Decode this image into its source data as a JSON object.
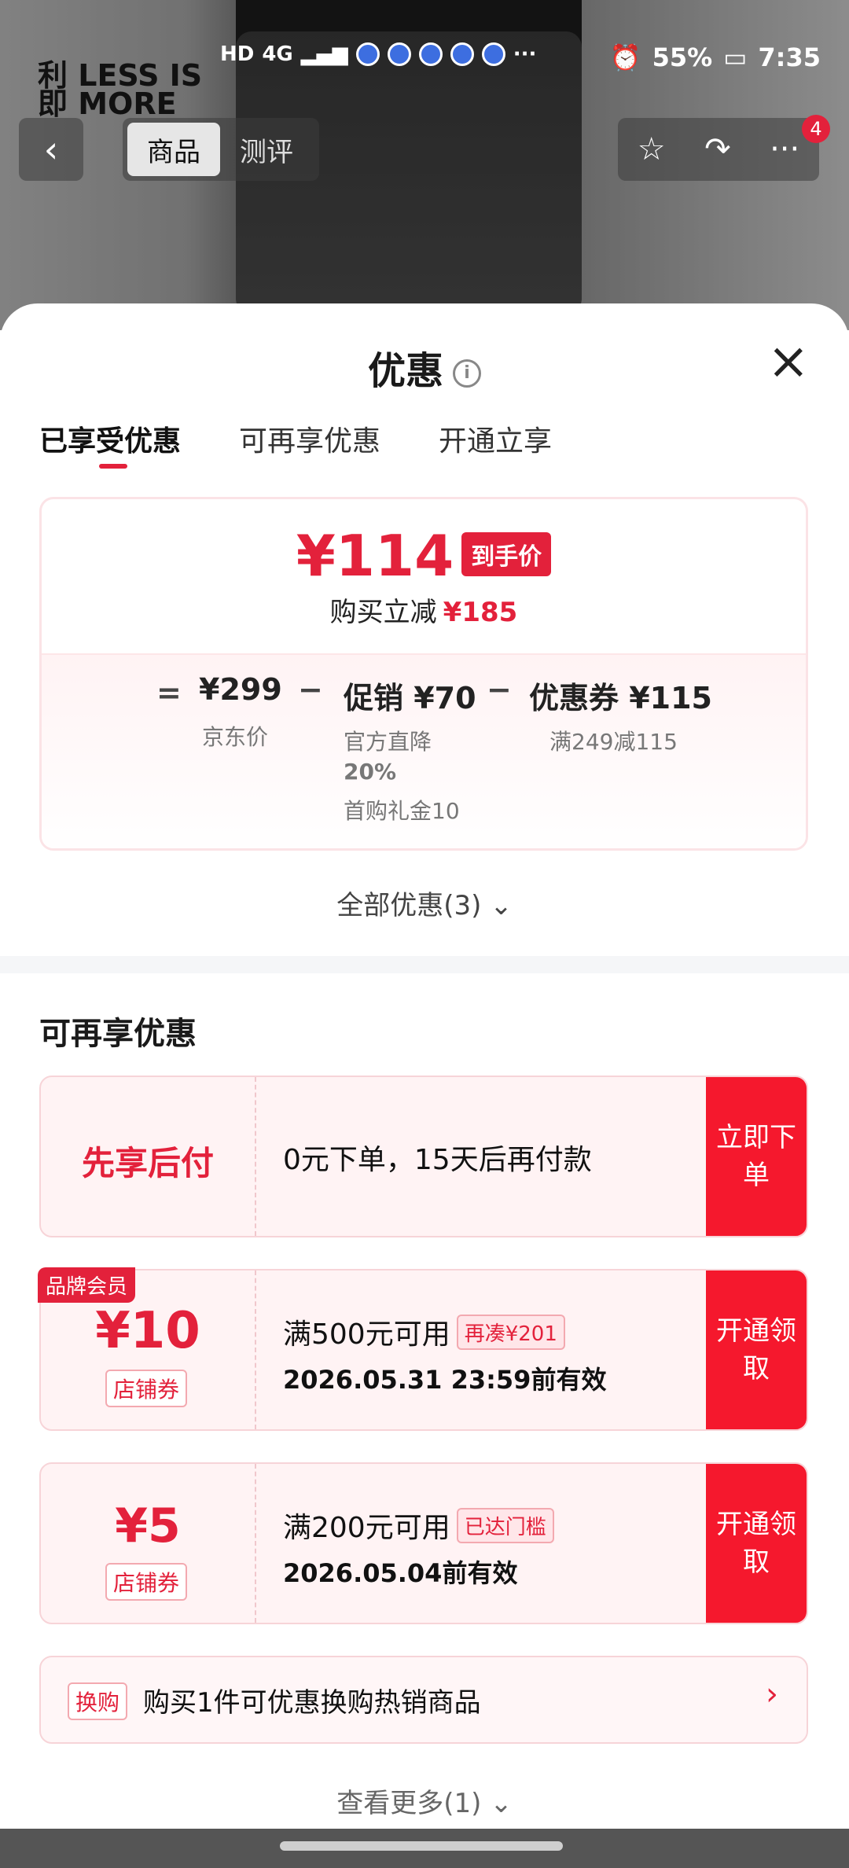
{
  "status": {
    "hd": "HD",
    "net": "4G",
    "battery": "55%",
    "time": "7:35",
    "dots": "···"
  },
  "brand": {
    "line1": "利 LESS IS",
    "line2": "即  MORE"
  },
  "topnav": {
    "back": "‹",
    "tab_product": "商品",
    "tab_review": "测评",
    "star": "☆",
    "share": "↷",
    "more": "···",
    "badge": "4"
  },
  "sheet": {
    "title": "优惠",
    "info": "i",
    "close": "×",
    "tabs": [
      "已享受优惠",
      "可再享优惠",
      "开通立享"
    ],
    "price": {
      "final": "¥114",
      "final_tag": "到手价",
      "save_label": "购买立减",
      "save_amount": "¥185",
      "eq": "=",
      "jd_price": "¥299",
      "jd_label": "京东价",
      "minus1": "−",
      "promo_main": "促销 ¥70",
      "promo_sub1": "官方直降",
      "promo_sub2": "20%",
      "promo_sub3": "首购礼金10",
      "minus2": "−",
      "coupon_main": "优惠券 ¥115",
      "coupon_sub": "满249减115"
    },
    "all_promos": "全部优惠(3) ⌄",
    "section2_title": "可再享优惠",
    "card1": {
      "left": "先享后付",
      "desc": "0元下单，15天后再付款",
      "action": "立即下单"
    },
    "member_badge": "品牌会员",
    "card2": {
      "amount": "¥10",
      "tag": "店铺券",
      "desc": "满500元可用",
      "chip": "再凑¥201",
      "expiry": "2026.05.31 23:59前有效",
      "action": "开通领取"
    },
    "card3": {
      "amount": "¥5",
      "tag": "店铺券",
      "desc": "满200元可用",
      "chip": "已达门槛",
      "expiry": "2026.05.04前有效",
      "action": "开通领取"
    },
    "swap": {
      "tag": "换购",
      "text": "购买1件可优惠换购热销商品",
      "arrow": "›"
    },
    "see_more": "查看更多(1) ⌄"
  }
}
